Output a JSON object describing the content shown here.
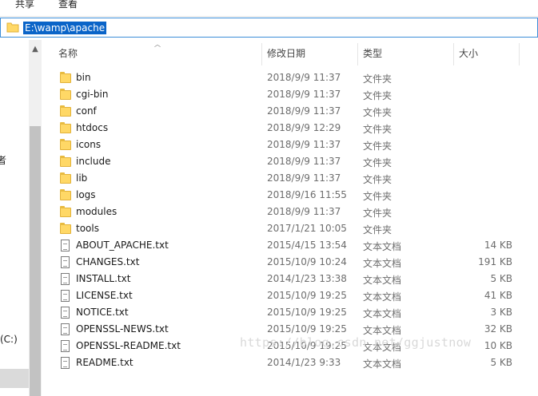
{
  "ribbon": {
    "tabs": [
      "共享",
      "查看"
    ]
  },
  "address": {
    "path": "E:\\wamp\\apache"
  },
  "nav": {
    "label_one": "者",
    "label_two": "(C:)"
  },
  "columns": {
    "name": "名称",
    "date": "修改日期",
    "type": "类型",
    "size": "大小"
  },
  "files": [
    {
      "name": "bin",
      "date": "2018/9/9 11:37",
      "type": "文件夹",
      "size": "",
      "icon": "folder-icon"
    },
    {
      "name": "cgi-bin",
      "date": "2018/9/9 11:37",
      "type": "文件夹",
      "size": "",
      "icon": "folder-icon"
    },
    {
      "name": "conf",
      "date": "2018/9/9 11:37",
      "type": "文件夹",
      "size": "",
      "icon": "folder-icon"
    },
    {
      "name": "htdocs",
      "date": "2018/9/9 12:29",
      "type": "文件夹",
      "size": "",
      "icon": "folder-icon"
    },
    {
      "name": "icons",
      "date": "2018/9/9 11:37",
      "type": "文件夹",
      "size": "",
      "icon": "folder-icon"
    },
    {
      "name": "include",
      "date": "2018/9/9 11:37",
      "type": "文件夹",
      "size": "",
      "icon": "folder-icon"
    },
    {
      "name": "lib",
      "date": "2018/9/9 11:37",
      "type": "文件夹",
      "size": "",
      "icon": "folder-icon"
    },
    {
      "name": "logs",
      "date": "2018/9/16 11:55",
      "type": "文件夹",
      "size": "",
      "icon": "folder-icon"
    },
    {
      "name": "modules",
      "date": "2018/9/9 11:37",
      "type": "文件夹",
      "size": "",
      "icon": "folder-icon"
    },
    {
      "name": "tools",
      "date": "2017/1/21 10:05",
      "type": "文件夹",
      "size": "",
      "icon": "folder-icon"
    },
    {
      "name": "ABOUT_APACHE.txt",
      "date": "2015/4/15 13:54",
      "type": "文本文档",
      "size": "14 KB",
      "icon": "text-file-icon"
    },
    {
      "name": "CHANGES.txt",
      "date": "2015/10/9 10:24",
      "type": "文本文档",
      "size": "191 KB",
      "icon": "text-file-icon"
    },
    {
      "name": "INSTALL.txt",
      "date": "2014/1/23 13:38",
      "type": "文本文档",
      "size": "5 KB",
      "icon": "text-file-icon"
    },
    {
      "name": "LICENSE.txt",
      "date": "2015/10/9 19:25",
      "type": "文本文档",
      "size": "41 KB",
      "icon": "text-file-icon"
    },
    {
      "name": "NOTICE.txt",
      "date": "2015/10/9 19:25",
      "type": "文本文档",
      "size": "3 KB",
      "icon": "text-file-icon"
    },
    {
      "name": "OPENSSL-NEWS.txt",
      "date": "2015/10/9 19:25",
      "type": "文本文档",
      "size": "32 KB",
      "icon": "text-file-icon"
    },
    {
      "name": "OPENSSL-README.txt",
      "date": "2015/10/9 19:25",
      "type": "文本文档",
      "size": "10 KB",
      "icon": "text-file-icon"
    },
    {
      "name": "README.txt",
      "date": "2014/1/23 9:33",
      "type": "文本文档",
      "size": "5 KB",
      "icon": "text-file-icon"
    }
  ],
  "watermark": "https://blog.csdn.net/ggjustnow"
}
